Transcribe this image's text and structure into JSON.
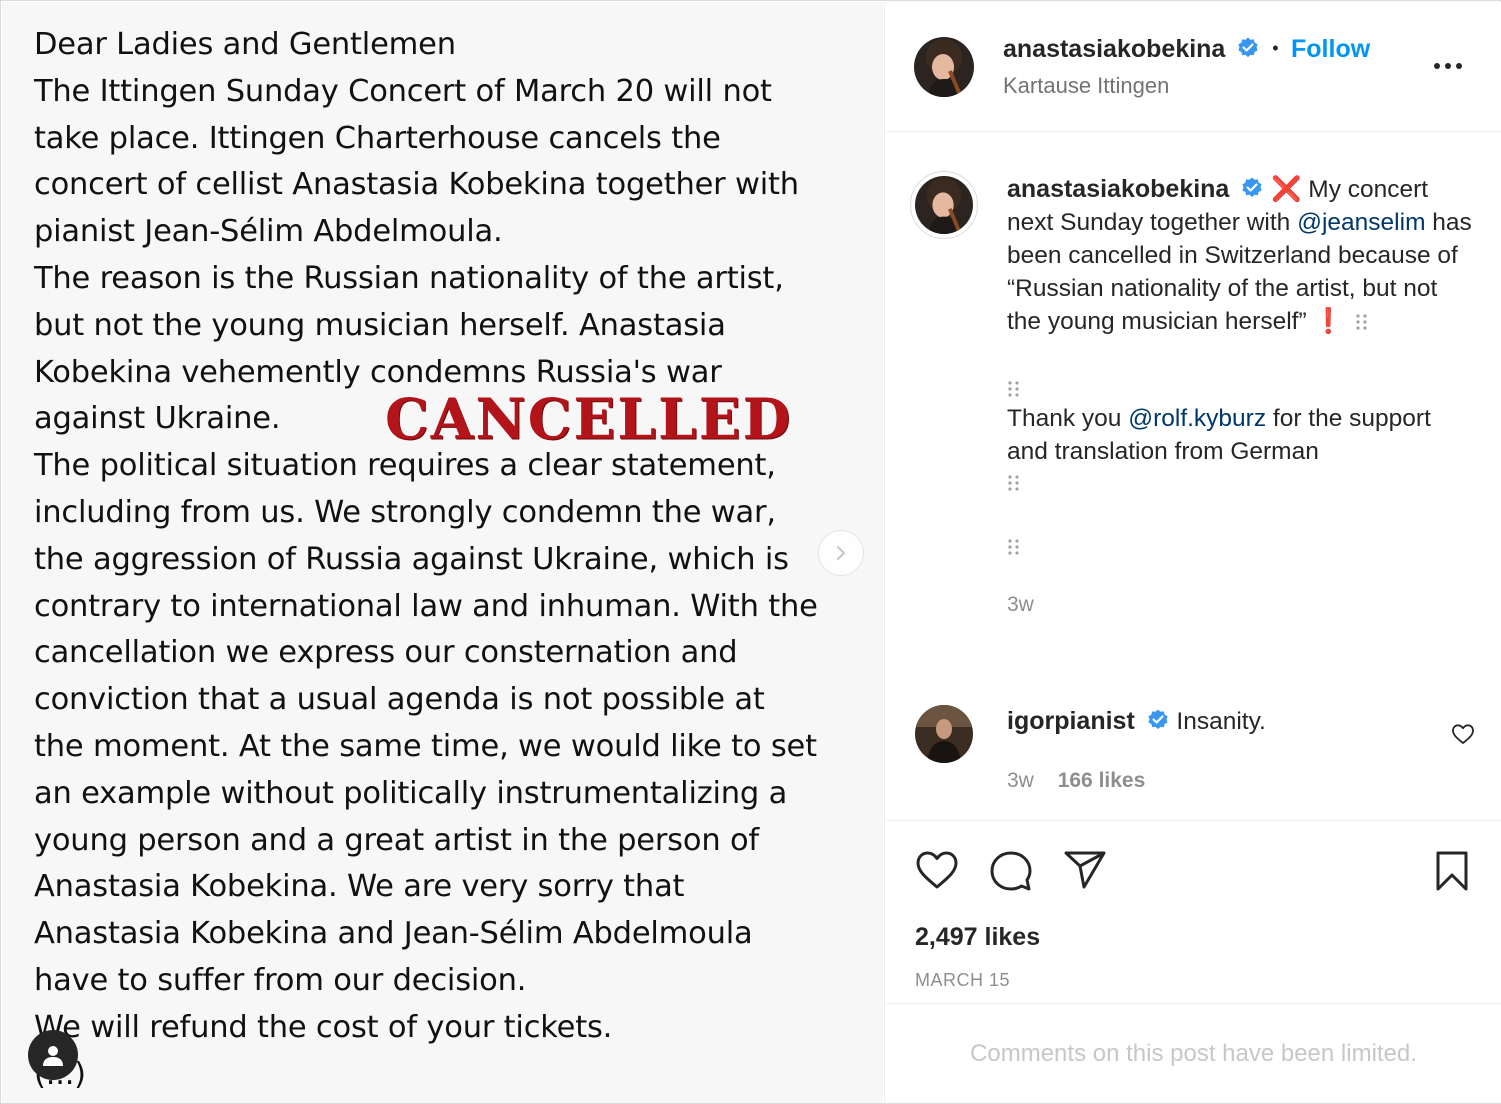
{
  "post_image": {
    "lines": [
      "Dear Ladies and Gentlemen",
      "The Ittingen Sunday Concert of March 20 will not",
      "take place. Ittingen Charterhouse cancels the",
      "concert of cellist Anastasia Kobekina together with",
      "pianist Jean-Sélim Abdelmoula.",
      "The reason is the Russian nationality of the artist,",
      "but not the young musician herself. Anastasia",
      "Kobekina vehemently condemns Russia's war",
      "against Ukraine.",
      "The political situation requires a clear statement,",
      "including from us. We strongly condemn the war,",
      "the aggression of Russia against Ukraine, which is",
      "contrary to international law and inhuman. With the",
      "cancellation we express our consternation and",
      "conviction that a usual agenda is not possible at",
      "the moment. At the same time, we would like to set",
      "an example without politically instrumentalizing a",
      "young person and a great artist in the person of",
      "Anastasia Kobekina. We are very sorry that",
      "Anastasia Kobekina and Jean-Sélim Abdelmoula",
      "have to suffer from our decision.",
      "We will refund the cost of your tickets.",
      "(...)"
    ],
    "stamp": "CANCELLED"
  },
  "header": {
    "username": "anastasiakobekina",
    "separator": "•",
    "follow_label": "Follow",
    "location": "Kartause Ittingen",
    "more_label": "•••"
  },
  "caption": {
    "username": "anastasiakobekina",
    "x_mark": "❌",
    "text_1": "My concert next Sunday together with ",
    "mention_1": "@jeanselim",
    "text_2": " has been cancelled in Switzerland because of “Russian nationality of the artist, but not the young musician herself” ",
    "exclaim": "❗",
    "thanks_1": "Thank you ",
    "mention_2": "@rolf.kyburz",
    "thanks_2": " for the support and translation from German",
    "time": "3w"
  },
  "comment": {
    "username": "igorpianist",
    "text": "Insanity.",
    "time": "3w",
    "likes": "166 likes"
  },
  "actions": {
    "likes": "2,497 likes",
    "date": "MARCH 15"
  },
  "footer": {
    "limited": "Comments on this post have been limited."
  },
  "colors": {
    "accent": "#0095f6",
    "mention": "#00376b",
    "stamp_red": "#b3141a"
  },
  "icons": [
    "chevron-right-icon",
    "user-tag-icon",
    "verified-badge-icon",
    "more-icon",
    "heart-icon",
    "comment-icon",
    "share-icon",
    "bookmark-icon",
    "braille-dots-icon"
  ]
}
